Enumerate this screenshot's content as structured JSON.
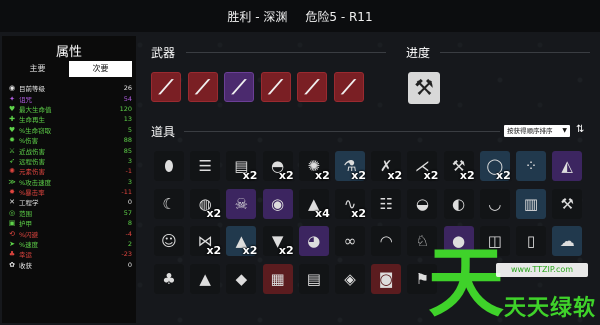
{
  "header": {
    "result": "胜利 - 深渊",
    "danger": "危险5 - R11"
  },
  "stats": {
    "title": "属性",
    "tabs": [
      "主要",
      "次要"
    ],
    "rows": [
      {
        "icon": "level-icon",
        "glyph": "◉",
        "label": "目前等级",
        "value": "26",
        "color": "#e8e8e8"
      },
      {
        "icon": "curse-icon",
        "glyph": "✦",
        "label": "诅咒",
        "value": "54",
        "color": "#b05ce0"
      },
      {
        "icon": "heart-icon",
        "glyph": "♥",
        "label": "最大生命值",
        "value": "120",
        "color": "#5fd44a"
      },
      {
        "icon": "regen-icon",
        "glyph": "✚",
        "label": "生命再生",
        "value": "13",
        "color": "#5fd44a"
      },
      {
        "icon": "steal-icon",
        "glyph": "♥",
        "label": "%生命窃取",
        "value": "5",
        "color": "#5fd44a"
      },
      {
        "icon": "damage-icon",
        "glyph": "✹",
        "label": "%伤害",
        "value": "88",
        "color": "#5fd44a"
      },
      {
        "icon": "melee-icon",
        "glyph": "⚔",
        "label": "近战伤害",
        "value": "85",
        "color": "#5fd44a"
      },
      {
        "icon": "ranged-icon",
        "glyph": "➶",
        "label": "远程伤害",
        "value": "3",
        "color": "#5fd44a"
      },
      {
        "icon": "elemental-icon",
        "glyph": "✺",
        "label": "元素伤害",
        "value": "-1",
        "color": "#e0453f"
      },
      {
        "icon": "attack-speed-icon",
        "glyph": "≫",
        "label": "%攻击速度",
        "value": "3",
        "color": "#5fd44a"
      },
      {
        "icon": "crit-icon",
        "glyph": "✸",
        "label": "%暴击率",
        "value": "-11",
        "color": "#e0453f"
      },
      {
        "icon": "engineering-icon",
        "glyph": "✕",
        "label": "工程学",
        "value": "0",
        "color": "#e8e8e8"
      },
      {
        "icon": "range-icon",
        "glyph": "◎",
        "label": "范围",
        "value": "57",
        "color": "#5fd44a"
      },
      {
        "icon": "armor-icon",
        "glyph": "▣",
        "label": "护甲",
        "value": "8",
        "color": "#5fd44a"
      },
      {
        "icon": "dodge-icon",
        "glyph": "⟲",
        "label": "%闪避",
        "value": "-4",
        "color": "#e0453f"
      },
      {
        "icon": "speed-icon",
        "glyph": "➤",
        "label": "%速度",
        "value": "2",
        "color": "#5fd44a"
      },
      {
        "icon": "luck-icon",
        "glyph": "♣",
        "label": "幸运",
        "value": "-23",
        "color": "#e0453f"
      },
      {
        "icon": "harvest-icon",
        "glyph": "✿",
        "label": "收获",
        "value": "0",
        "color": "#e8e8e8"
      }
    ]
  },
  "weapons": {
    "title": "武器",
    "slots": [
      {
        "icon": "cleaver-icon",
        "tier": "red"
      },
      {
        "icon": "cleaver-icon",
        "tier": "red"
      },
      {
        "icon": "cleaver-icon",
        "tier": "purple"
      },
      {
        "icon": "cleaver-icon",
        "tier": "red"
      },
      {
        "icon": "cleaver-icon",
        "tier": "red"
      },
      {
        "icon": "cleaver-icon",
        "tier": "red"
      }
    ]
  },
  "progress": {
    "title": "进度",
    "slot": {
      "icon": "spiked-club-icon"
    }
  },
  "items": {
    "title": "道具",
    "sort_label": "按获得顺序排序",
    "sort_order_icon": "sort-order-icon",
    "rows": [
      [
        {
          "icon": "egg-icon",
          "tier": "dark",
          "count": ""
        },
        {
          "icon": "bone-pile-icon",
          "tier": "dark",
          "count": ""
        },
        {
          "icon": "scroll-icon",
          "tier": "dark",
          "count": "x2"
        },
        {
          "icon": "helmet-icon",
          "tier": "dark",
          "count": "x2"
        },
        {
          "icon": "hedgehog-icon",
          "tier": "dark",
          "count": "x2"
        },
        {
          "icon": "potion-icon",
          "tier": "blue",
          "count": "x2"
        },
        {
          "icon": "sword-icon",
          "tier": "dark",
          "count": "x2"
        },
        {
          "icon": "claw-icon",
          "tier": "dark",
          "count": "x2"
        },
        {
          "icon": "wrench-icon",
          "tier": "dark",
          "count": "x2"
        },
        {
          "icon": "ring-icon",
          "tier": "blue",
          "count": "x2"
        },
        {
          "icon": "dots-icon",
          "tier": "blue",
          "count": ""
        },
        {
          "icon": "cat-icon",
          "tier": "purple",
          "count": ""
        }
      ],
      [
        {
          "icon": "scythe-icon",
          "tier": "dark",
          "count": ""
        },
        {
          "icon": "bag-icon",
          "tier": "dark",
          "count": "x2"
        },
        {
          "icon": "skull-icon",
          "tier": "purple",
          "count": ""
        },
        {
          "icon": "eye-icon",
          "tier": "purple",
          "count": ""
        },
        {
          "icon": "hat-icon",
          "tier": "dark",
          "count": "x4"
        },
        {
          "icon": "snake-icon",
          "tier": "dark",
          "count": "x2"
        },
        {
          "icon": "ladder-icon",
          "tier": "dark",
          "count": ""
        },
        {
          "icon": "mask-icon",
          "tier": "dark",
          "count": ""
        },
        {
          "icon": "penguin-icon",
          "tier": "dark",
          "count": ""
        },
        {
          "icon": "bowl-icon",
          "tier": "dark",
          "count": ""
        },
        {
          "icon": "jar-icon",
          "tier": "blue",
          "count": ""
        },
        {
          "icon": "axe-icon",
          "tier": "dark",
          "count": ""
        }
      ],
      [
        {
          "icon": "face-icon",
          "tier": "dark",
          "count": ""
        },
        {
          "icon": "fish-icon",
          "tier": "dark",
          "count": "x2"
        },
        {
          "icon": "cone-icon",
          "tier": "blue",
          "count": "x2"
        },
        {
          "icon": "tooth-icon",
          "tier": "dark",
          "count": "x2"
        },
        {
          "icon": "shell-icon",
          "tier": "purple",
          "count": ""
        },
        {
          "icon": "chain-icon",
          "tier": "dark",
          "count": ""
        },
        {
          "icon": "dome-icon",
          "tier": "dark",
          "count": ""
        },
        {
          "icon": "rabbit-icon",
          "tier": "dark",
          "count": ""
        },
        {
          "icon": "slime-icon",
          "tier": "purple",
          "count": ""
        },
        {
          "icon": "cup-icon",
          "tier": "dark",
          "count": ""
        },
        {
          "icon": "bottle-icon",
          "tier": "dark",
          "count": ""
        },
        {
          "icon": "ghost-icon",
          "tier": "blue",
          "count": ""
        }
      ],
      [
        {
          "icon": "tree-icon",
          "tier": "dark",
          "count": ""
        },
        {
          "icon": "witch-icon",
          "tier": "dark",
          "count": ""
        },
        {
          "icon": "crystal-icon",
          "tier": "dark",
          "count": ""
        },
        {
          "icon": "crate-icon",
          "tier": "red",
          "count": ""
        },
        {
          "icon": "book-icon",
          "tier": "dark",
          "count": ""
        },
        {
          "icon": "lantern-icon",
          "tier": "dark",
          "count": ""
        },
        {
          "icon": "basket-icon",
          "tier": "red",
          "count": ""
        },
        {
          "icon": "flag-icon",
          "tier": "dark",
          "count": ""
        }
      ]
    ]
  },
  "watermark": {
    "big": "天",
    "url": "www.TTZIP.com",
    "text": "天天绿软"
  }
}
